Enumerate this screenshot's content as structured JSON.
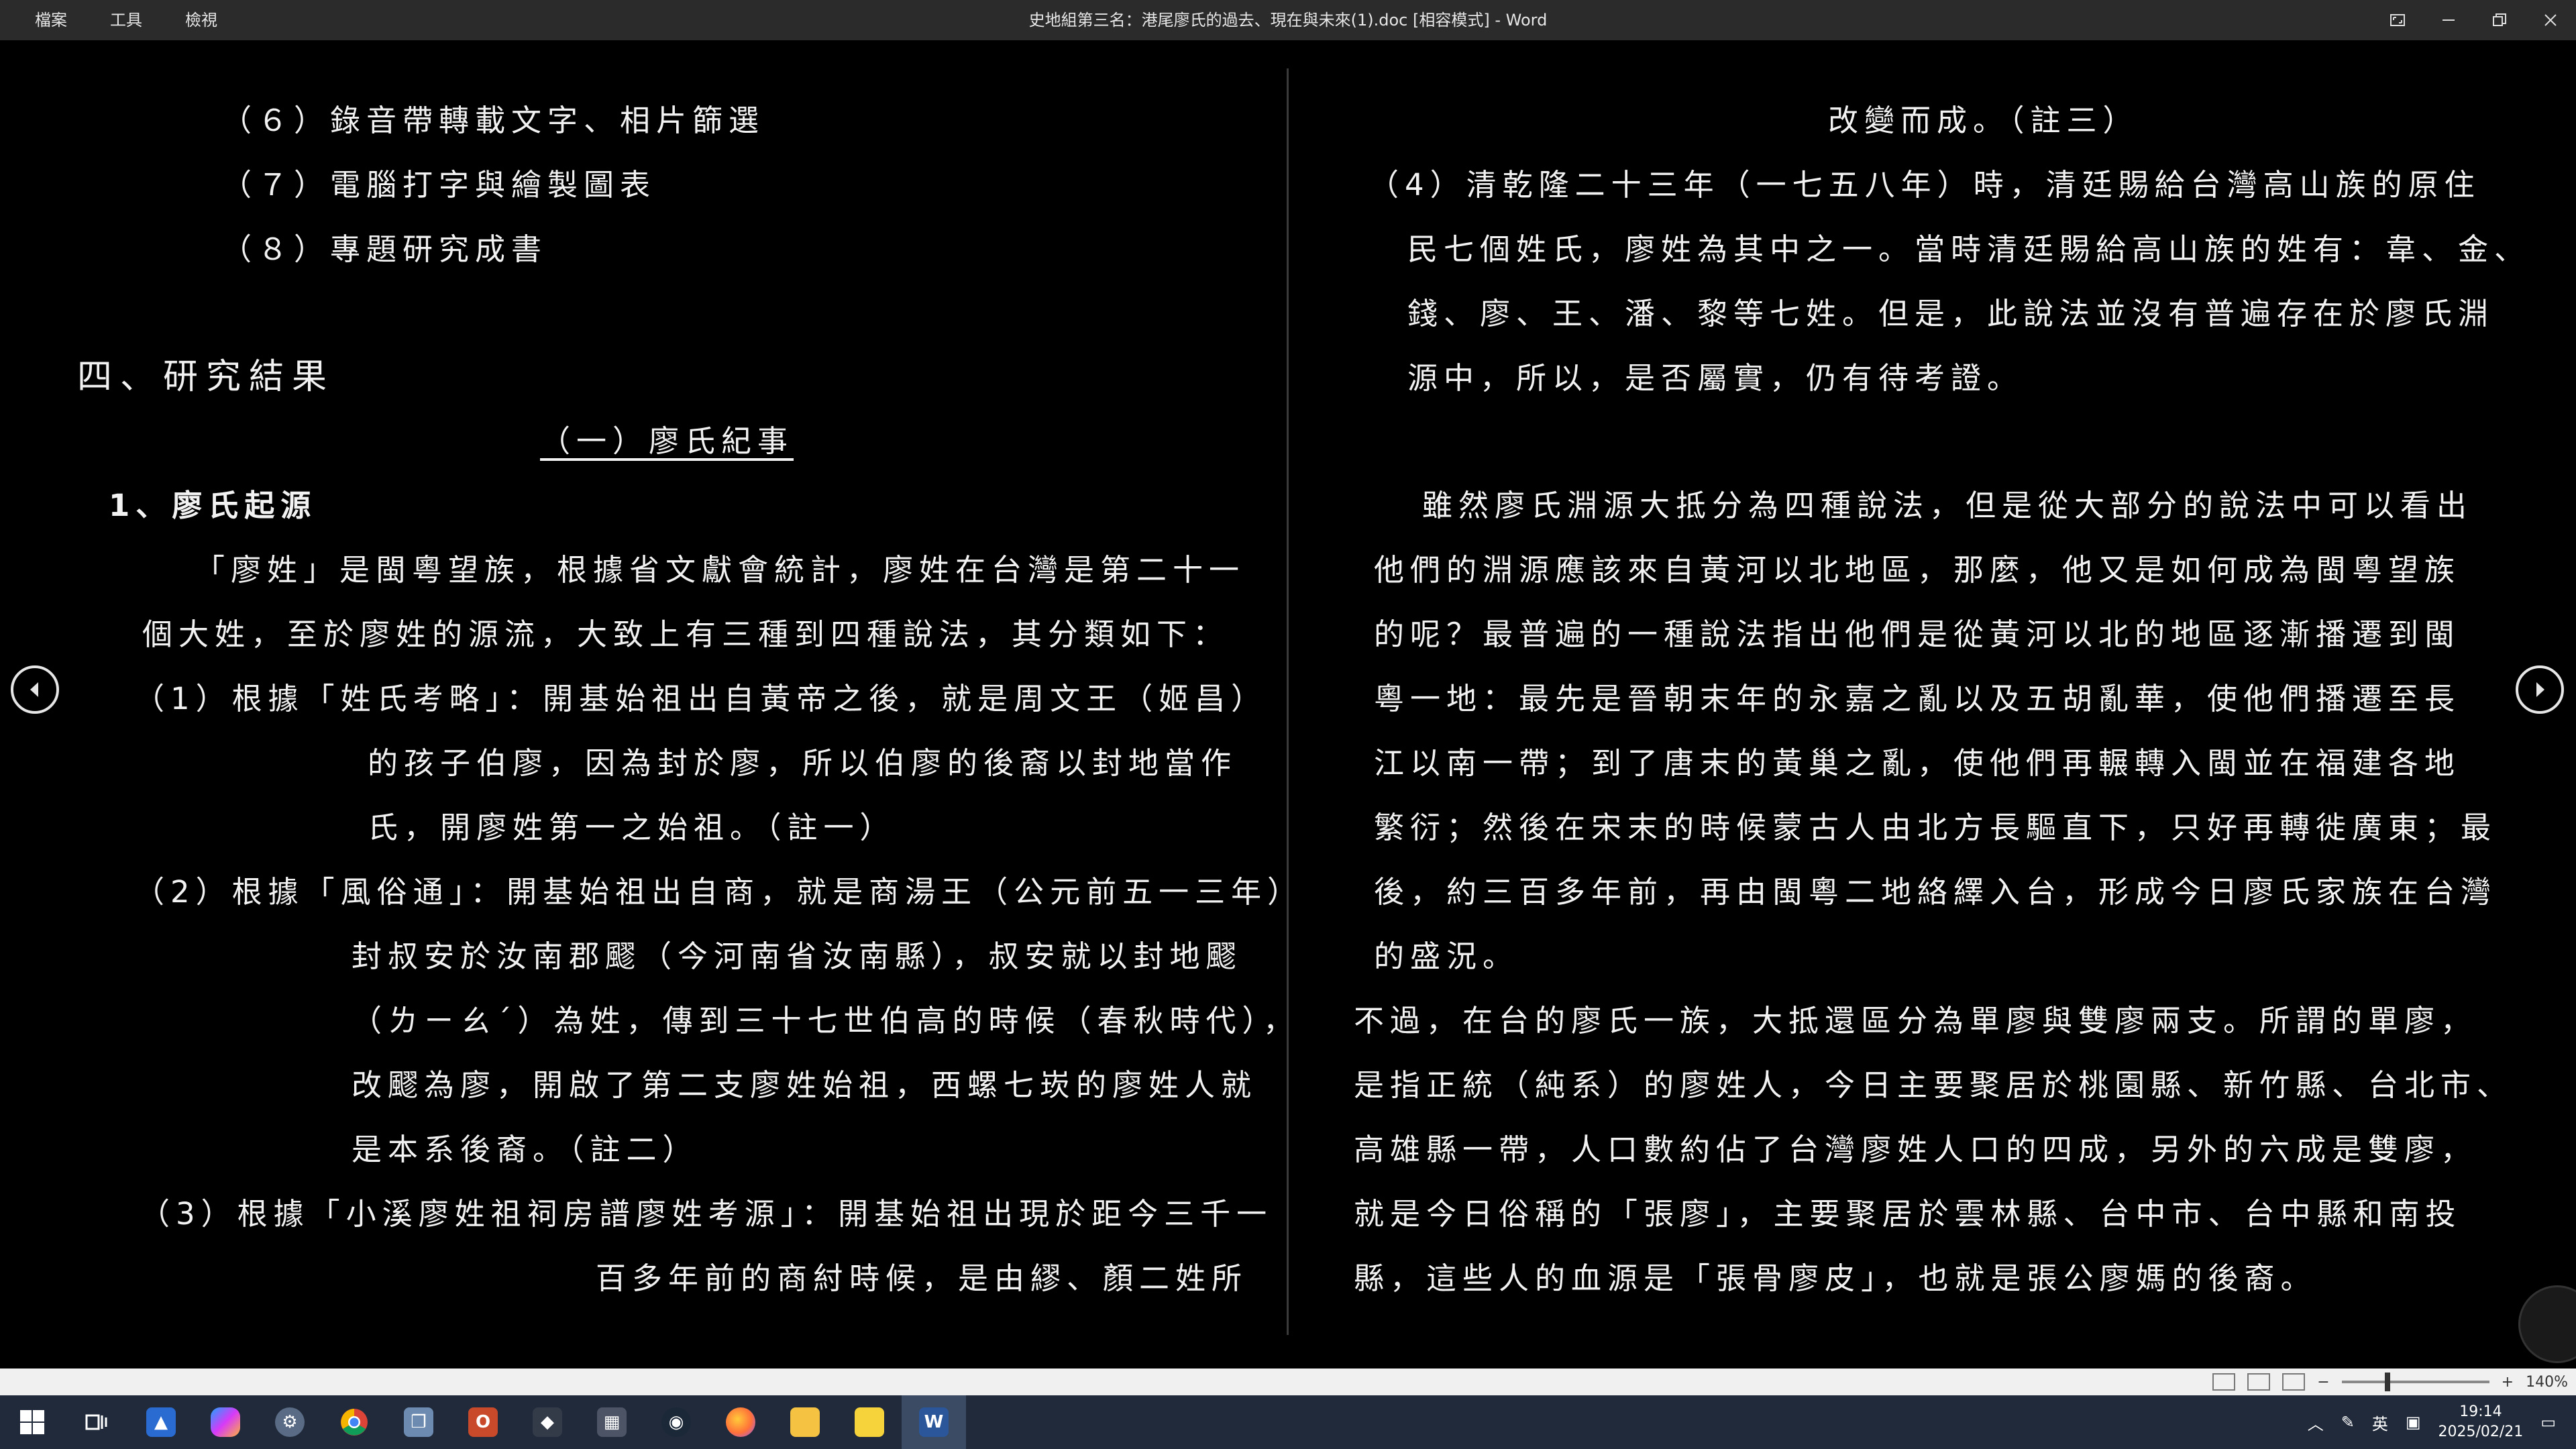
{
  "menu": [
    "檔案",
    "工具",
    "檢視"
  ],
  "window": {
    "title": "史地組第三名：港尾廖氏的過去、現在與未來(1).doc [相容模式]  -  Word"
  },
  "doc": {
    "left": [
      "（６）錄音帶轉載文字、相片篩選",
      "（７）電腦打字與繪製圖表",
      "（８）專題研究成書",
      "四、研究結果",
      "（一）廖氏紀事",
      "1、廖氏起源",
      "「廖姓」是閩粵望族，根據省文獻會統計，廖姓在台灣是第二十一",
      "個大姓，至於廖姓的源流，大致上有三種到四種說法，其分類如下：",
      "（1）根據「姓氏考略」：開基始祖出自黃帝之後，就是周文王（姬昌）",
      "的孩子伯廖，因為封於廖，所以伯廖的後裔以封地當作",
      "氏，開廖姓第一之始祖。（註一）",
      "（2）根據「風俗通」：開基始祖出自商，就是商湯王（公元前五一三年）",
      "封叔安於汝南郡飂（今河南省汝南縣），叔安就以封地飂",
      "（ㄌㄧㄠˊ）為姓，傳到三十七世伯高的時候（春秋時代），",
      "改飂為廖，開啟了第二支廖姓始祖，西螺七崁的廖姓人就",
      "是本系後裔。（註二）",
      "（3）根據「小溪廖姓祖祠房譜廖姓考源」：開基始祖出現於距今三千一",
      "百多年前的商紂時候，是由繆、顏二姓所"
    ],
    "right": [
      "改變而成。（註三）",
      "（4）清乾隆二十三年（一七五八年）時，清廷賜給台灣高山族的原住",
      "民七個姓氏，廖姓為其中之一。當時清廷賜給高山族的姓有：韋、金、",
      "錢、廖、王、潘、黎等七姓。但是，此說法並沒有普遍存在於廖氏淵",
      "源中，所以，是否屬實，仍有待考證。",
      "雖然廖氏淵源大抵分為四種說法，但是從大部分的說法中可以看出",
      "他們的淵源應該來自黃河以北地區，那麼，他又是如何成為閩粵望族",
      "的呢？最普遍的一種說法指出他們是從黃河以北的地區逐漸播遷到閩",
      "粵一地：最先是晉朝末年的永嘉之亂以及五胡亂華，使他們播遷至長",
      "江以南一帶；到了唐末的黃巢之亂，使他們再輾轉入閩並在福建各地",
      "繁衍；然後在宋末的時候蒙古人由北方長驅直下，只好再轉徙廣東；最",
      "後，約三百多年前，再由閩粵二地絡繹入台，形成今日廖氏家族在台灣",
      "的盛況。",
      "不過，在台的廖氏一族，大抵還區分為單廖與雙廖兩支。所謂的單廖，",
      "是指正統（純系）的廖姓人，今日主要聚居於桃園縣、新竹縣、台北市、",
      "高雄縣一帶，人口數約佔了台灣廖姓人口的四成，另外的六成是雙廖，",
      "就是今日俗稱的「張廖」，主要聚居於雲林縣、台中市、台中縣和南投",
      "縣，這些人的血源是「張骨廖皮」，也就是張公廖媽的後裔。"
    ]
  },
  "status": {
    "zoom": "140%"
  },
  "taskbar": {
    "time": "19:14",
    "date": "2025/02/21",
    "lang": "英",
    "apps": [
      "start",
      "task-view",
      "app-blue",
      "copilot",
      "app-gear",
      "chrome",
      "app-paper",
      "app-office",
      "app-fox",
      "calculator",
      "steam",
      "firefox",
      "file-explorer",
      "sticky-notes",
      "word"
    ]
  }
}
